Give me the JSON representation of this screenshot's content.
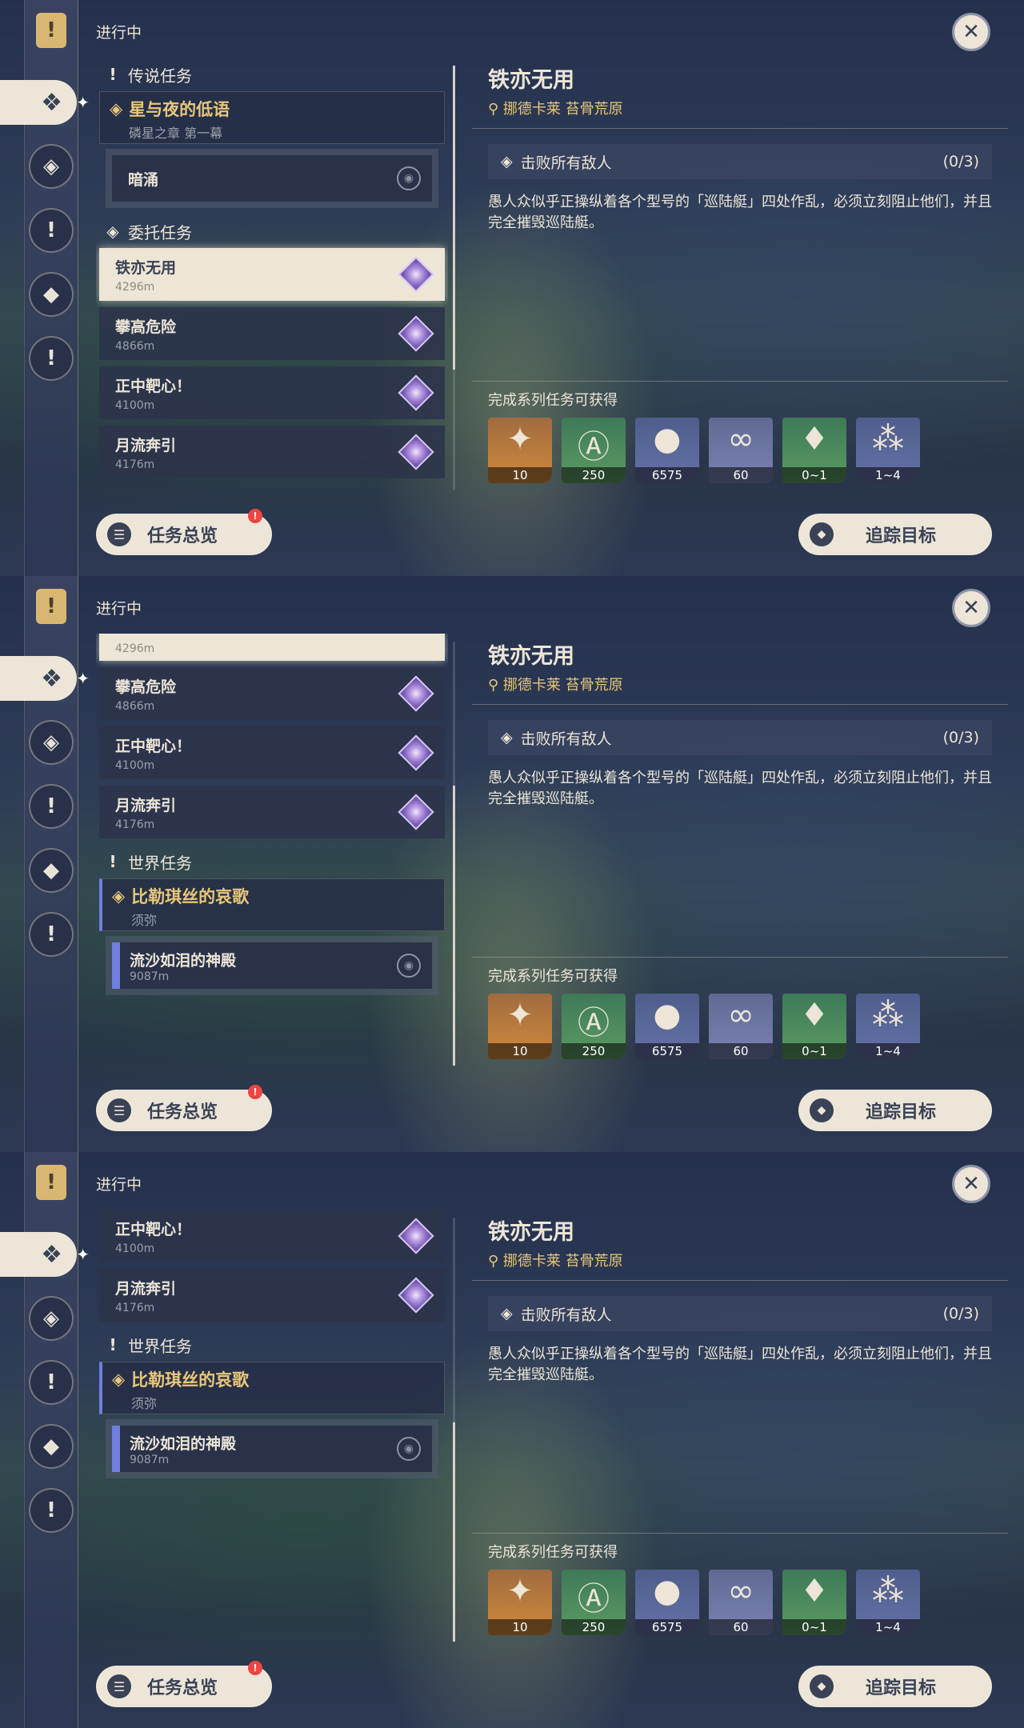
{
  "status": "进行中",
  "detail": {
    "title": "铁亦无用",
    "location": "挪德卡莱 苔骨荒原",
    "objective": "击败所有敌人",
    "progress": "(0/3)",
    "description": "愚人众似乎正操纵着各个型号的「巡陆艇」四处作乱，必须立刻阻止他们，并且完全摧毁巡陆艇。",
    "reward_label": "完成系列任务可获得",
    "rewards": [
      {
        "icon": "primogem-icon",
        "count": "10"
      },
      {
        "icon": "adventure-exp-icon",
        "count": "250"
      },
      {
        "icon": "mora-icon",
        "count": "6575"
      },
      {
        "icon": "friendship-exp-icon",
        "count": "60"
      },
      {
        "icon": "crystal-icon",
        "count": "0~1"
      },
      {
        "icon": "crystal-cluster-icon",
        "count": "1~4"
      }
    ]
  },
  "categories": {
    "legend": "传说任务",
    "commission": "委托任务",
    "world": "世界任务"
  },
  "legend_series": {
    "title": "星与夜的低语",
    "subtitle": "磷星之章 第一幕"
  },
  "legend_sub": {
    "name": "暗涌"
  },
  "world_series": {
    "title": "比勒琪丝的哀歌",
    "subtitle": "须弥"
  },
  "world_sub": {
    "name": "流沙如泪的神殿",
    "distance": "9087m"
  },
  "quests": [
    {
      "name": "铁亦无用",
      "distance": "4296m"
    },
    {
      "name": "攀高危险",
      "distance": "4866m"
    },
    {
      "name": "正中靶心！",
      "distance": "4100m"
    },
    {
      "name": "月流奔引",
      "distance": "4176m"
    }
  ],
  "buttons": {
    "overview": "任务总览",
    "badge": "!",
    "track": "追踪目标"
  },
  "colors": {
    "accent": "#e8c77a",
    "panel": "#ece5d8",
    "world_marker": "#6e7fe0"
  }
}
